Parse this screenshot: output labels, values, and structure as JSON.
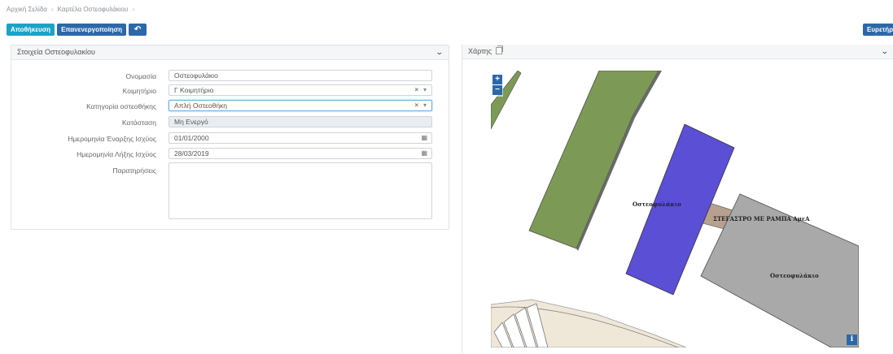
{
  "breadcrumb": {
    "home": "Αρχική Σελίδα",
    "current": "Καρτέλα Οστεοφυλάκιου"
  },
  "toolbar": {
    "save_label": "Αποθήκευση",
    "reactivate_label": "Επανενεργοποίηση",
    "reset_icon": "undo-icon",
    "index_label": "Ευρετήρ"
  },
  "form": {
    "title": "Στοιχεία Οστεοφυλακίου",
    "fields": {
      "name": {
        "label": "Ονομασία",
        "value": "Οστεοφυλάκιο"
      },
      "cemetery": {
        "label": "Κοιμητήριο",
        "value": "Γ Κοιμητήριο"
      },
      "category": {
        "label": "Κατηγορία οστεοθήκης",
        "value": "Απλή Οστεοθήκη"
      },
      "status": {
        "label": "Κατάσταση",
        "value": "Μη Ενεργό"
      },
      "start_date": {
        "label": "Ημερομηνία Έναρξης Ισχύος",
        "value": "01/01/2000"
      },
      "end_date": {
        "label": "Ημερομηνία Λήξης Ισχύος",
        "value": "28/03/2019"
      },
      "notes": {
        "label": "Παρατηρήσεις",
        "value": ""
      }
    }
  },
  "map_panel": {
    "title": "Χάρτης",
    "zoom_in": "+",
    "zoom_out": "−",
    "info": "i",
    "labels": {
      "ossuary_blue": "Οστεοφυλάκιο",
      "shelter": "ΣΤΕΓΑΣΤΡΟ ΜΕ ΡΑΜΠΑ ΑμεΑ",
      "ossuary_grey": "Οστεοφυλάκιο"
    },
    "colors": {
      "green": "#7c9a56",
      "blue": "#5b4fd6",
      "grey": "#a9a9a9",
      "brown": "#b8a090",
      "beige": "#efe7d8"
    }
  },
  "icons": {
    "collapse": "chevron-down-icon",
    "copy": "copy-icon",
    "calendar": "calendar-icon",
    "clear": "clear-icon",
    "dropdown": "caret-down-icon"
  }
}
